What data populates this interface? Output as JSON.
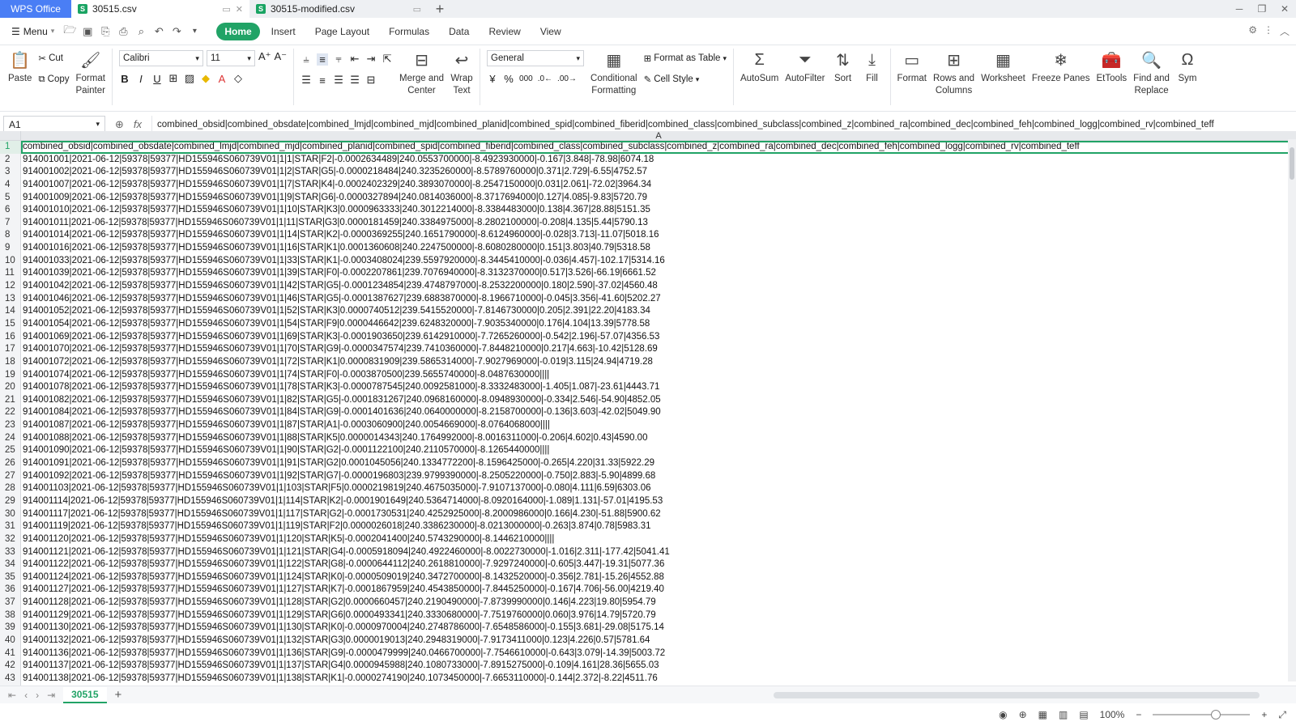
{
  "tabs": {
    "app": "WPS Office",
    "doc1": "30515.csv",
    "doc2": "30515-modified.csv"
  },
  "menubar": {
    "menu": "Menu",
    "tabs": [
      "Home",
      "Insert",
      "Page Layout",
      "Formulas",
      "Data",
      "Review",
      "View"
    ]
  },
  "ribbon": {
    "paste": "Paste",
    "cut": "Cut",
    "copy": "Copy",
    "format_painter_1": "Format",
    "format_painter_2": "Painter",
    "font": "Calibri",
    "size": "11",
    "merge_1": "Merge and",
    "merge_2": "Center",
    "wrap_1": "Wrap",
    "wrap_2": "Text",
    "number_format": "General",
    "cond_1": "Conditional",
    "cond_2": "Formatting",
    "format_table": "Format as Table",
    "cell_style": "Cell Style",
    "autosum": "AutoSum",
    "autofilter": "AutoFilter",
    "sort": "Sort",
    "fill": "Fill",
    "format": "Format",
    "rowscols_1": "Rows and",
    "rowscols_2": "Columns",
    "worksheet": "Worksheet",
    "freeze": "Freeze Panes",
    "ettools": "EtTools",
    "find_1": "Find and",
    "find_2": "Replace",
    "sym": "Sym"
  },
  "formula_bar": {
    "cell_ref": "A1",
    "fx": "fx",
    "content": "combined_obsid|combined_obsdate|combined_lmjd|combined_mjd|combined_planid|combined_spid|combined_fiberid|combined_class|combined_subclass|combined_z|combined_ra|combined_dec|combined_feh|combined_logg|combined_rv|combined_teff"
  },
  "grid": {
    "column_header": "A",
    "rows": [
      "combined_obsid|combined_obsdate|combined_lmjd|combined_mjd|combined_planid|combined_spid|combined_fiberid|combined_class|combined_subclass|combined_z|combined_ra|combined_dec|combined_feh|combined_logg|combined_rv|combined_teff",
      "914001001|2021-06-12|59378|59377|HD155946S060739V01|1|1|STAR|F2|-0.0002634489|240.0553700000|-8.4923930000|-0.167|3.848|-78.98|6074.18",
      "914001002|2021-06-12|59378|59377|HD155946S060739V01|1|2|STAR|G5|-0.0000218484|240.3235260000|-8.5789760000|0.371|2.729|-6.55|4752.57",
      "914001007|2021-06-12|59378|59377|HD155946S060739V01|1|7|STAR|K4|-0.0002402329|240.3893070000|-8.2547150000|0.031|2.061|-72.02|3964.34",
      "914001009|2021-06-12|59378|59377|HD155946S060739V01|1|9|STAR|G6|-0.0000327894|240.0814036000|-8.3717694000|0.127|4.085|-9.83|5720.79",
      "914001010|2021-06-12|59378|59377|HD155946S060739V01|1|10|STAR|K3|0.0000963333|240.3012214000|-8.3384483000|0.138|4.367|28.88|5151.35",
      "914001011|2021-06-12|59378|59377|HD155946S060739V01|1|11|STAR|G3|0.0000181459|240.3384975000|-8.2802100000|-0.208|4.135|5.44|5790.13",
      "914001014|2021-06-12|59378|59377|HD155946S060739V01|1|14|STAR|K2|-0.0000369255|240.1651790000|-8.6124960000|-0.028|3.713|-11.07|5018.16",
      "914001016|2021-06-12|59378|59377|HD155946S060739V01|1|16|STAR|K1|0.0001360608|240.2247500000|-8.6080280000|0.151|3.803|40.79|5318.58",
      "914001033|2021-06-12|59378|59377|HD155946S060739V01|1|33|STAR|K1|-0.0003408024|239.5597920000|-8.3445410000|-0.036|4.457|-102.17|5314.16",
      "914001039|2021-06-12|59378|59377|HD155946S060739V01|1|39|STAR|F0|-0.0002207861|239.7076940000|-8.3132370000|0.517|3.526|-66.19|6661.52",
      "914001042|2021-06-12|59378|59377|HD155946S060739V01|1|42|STAR|G5|-0.0001234854|239.4748797000|-8.2532200000|0.180|2.590|-37.02|4560.48",
      "914001046|2021-06-12|59378|59377|HD155946S060739V01|1|46|STAR|G5|-0.0001387627|239.6883870000|-8.1966710000|-0.045|3.356|-41.60|5202.27",
      "914001052|2021-06-12|59378|59377|HD155946S060739V01|1|52|STAR|K3|0.0000740512|239.5415520000|-7.8146730000|0.205|2.391|22.20|4183.34",
      "914001054|2021-06-12|59378|59377|HD155946S060739V01|1|54|STAR|F9|0.0000446642|239.6248320000|-7.9035340000|0.176|4.104|13.39|5778.58",
      "914001069|2021-06-12|59378|59377|HD155946S060739V01|1|69|STAR|K3|-0.0001903650|239.6142910000|-7.7265260000|-0.542|2.196|-57.07|4356.53",
      "914001070|2021-06-12|59378|59377|HD155946S060739V01|1|70|STAR|G9|-0.0000347574|239.7410360000|-7.8448210000|0.217|4.663|-10.42|5128.69",
      "914001072|2021-06-12|59378|59377|HD155946S060739V01|1|72|STAR|K1|0.0000831909|239.5865314000|-7.9027969000|-0.019|3.115|24.94|4719.28",
      "914001074|2021-06-12|59378|59377|HD155946S060739V01|1|74|STAR|F0|-0.0003870500|239.5655740000|-8.0487630000||||",
      "914001078|2021-06-12|59378|59377|HD155946S060739V01|1|78|STAR|K3|-0.0000787545|240.0092581000|-8.3332483000|-1.405|1.087|-23.61|4443.71",
      "914001082|2021-06-12|59378|59377|HD155946S060739V01|1|82|STAR|G5|-0.0001831267|240.0968160000|-8.0948930000|-0.334|2.546|-54.90|4852.05",
      "914001084|2021-06-12|59378|59377|HD155946S060739V01|1|84|STAR|G9|-0.0001401636|240.0640000000|-8.2158700000|-0.136|3.603|-42.02|5049.90",
      "914001087|2021-06-12|59378|59377|HD155946S060739V01|1|87|STAR|A1|-0.0003060900|240.0054669000|-8.0764068000||||",
      "914001088|2021-06-12|59378|59377|HD155946S060739V01|1|88|STAR|K5|0.0000014343|240.1764992000|-8.0016311000|-0.206|4.602|0.43|4590.00",
      "914001090|2021-06-12|59378|59377|HD155946S060739V01|1|90|STAR|G2|-0.0001122100|240.2110570000|-8.1265440000||||",
      "914001091|2021-06-12|59378|59377|HD155946S060739V01|1|91|STAR|G2|0.0001045056|240.1334772200|-8.1596425000|-0.265|4.220|31.33|5922.29",
      "914001092|2021-06-12|59378|59377|HD155946S060739V01|1|92|STAR|G7|-0.0000196803|239.9799390000|-8.2505220000|-0.750|2.883|-5.90|4899.68",
      "914001103|2021-06-12|59378|59377|HD155946S060739V01|1|103|STAR|F5|0.0000219819|240.4675035000|-7.9107137000|-0.080|4.111|6.59|6303.06",
      "914001114|2021-06-12|59378|59377|HD155946S060739V01|1|114|STAR|K2|-0.0001901649|240.5364714000|-8.0920164000|-1.089|1.131|-57.01|4195.53",
      "914001117|2021-06-12|59378|59377|HD155946S060739V01|1|117|STAR|G2|-0.0001730531|240.4252925000|-8.2000986000|0.166|4.230|-51.88|5900.62",
      "914001119|2021-06-12|59378|59377|HD155946S060739V01|1|119|STAR|F2|0.0000026018|240.3386230000|-8.0213000000|-0.263|3.874|0.78|5983.31",
      "914001120|2021-06-12|59378|59377|HD155946S060739V01|1|120|STAR|K5|-0.0002041400|240.5743290000|-8.1446210000||||",
      "914001121|2021-06-12|59378|59377|HD155946S060739V01|1|121|STAR|G4|-0.0005918094|240.4922460000|-8.0022730000|-1.016|2.311|-177.42|5041.41",
      "914001122|2021-06-12|59378|59377|HD155946S060739V01|1|122|STAR|G8|-0.0000644112|240.2618810000|-7.9297240000|-0.605|3.447|-19.31|5077.36",
      "914001124|2021-06-12|59378|59377|HD155946S060739V01|1|124|STAR|K0|-0.0000509019|240.3472700000|-8.1432520000|-0.356|2.781|-15.26|4552.88",
      "914001127|2021-06-12|59378|59377|HD155946S060739V01|1|127|STAR|K7|-0.0001867959|240.4543850000|-7.8445250000|-0.167|4.706|-56.00|4219.40",
      "914001128|2021-06-12|59378|59377|HD155946S060739V01|1|128|STAR|G2|0.0000660457|240.2190490000|-7.8739990000|0.146|4.223|19.80|5954.79",
      "914001129|2021-06-12|59378|59377|HD155946S060739V01|1|129|STAR|G6|0.0000493341|240.3330680000|-7.7519760000|0.060|3.976|14.79|5720.79",
      "914001130|2021-06-12|59378|59377|HD155946S060739V01|1|130|STAR|K0|-0.0000970004|240.2748786000|-7.6548586000|-0.155|3.681|-29.08|5175.14",
      "914001132|2021-06-12|59378|59377|HD155946S060739V01|1|132|STAR|G3|0.0000019013|240.2948319000|-7.9173411000|0.123|4.226|0.57|5781.64",
      "914001136|2021-06-12|59378|59377|HD155946S060739V01|1|136|STAR|G9|-0.0000479999|240.0466700000|-7.7546610000|-0.643|3.079|-14.39|5003.72",
      "914001137|2021-06-12|59378|59377|HD155946S060739V01|1|137|STAR|G4|0.0000945988|240.1080733000|-7.8915275000|-0.109|4.161|28.36|5655.03",
      "914001138|2021-06-12|59378|59377|HD155946S060739V01|1|138|STAR|K1|-0.0000274190|240.1073450000|-7.6653110000|-0.144|2.372|-8.22|4511.76"
    ]
  },
  "sheets": {
    "active": "30515"
  },
  "status": {
    "zoom": "100%"
  }
}
